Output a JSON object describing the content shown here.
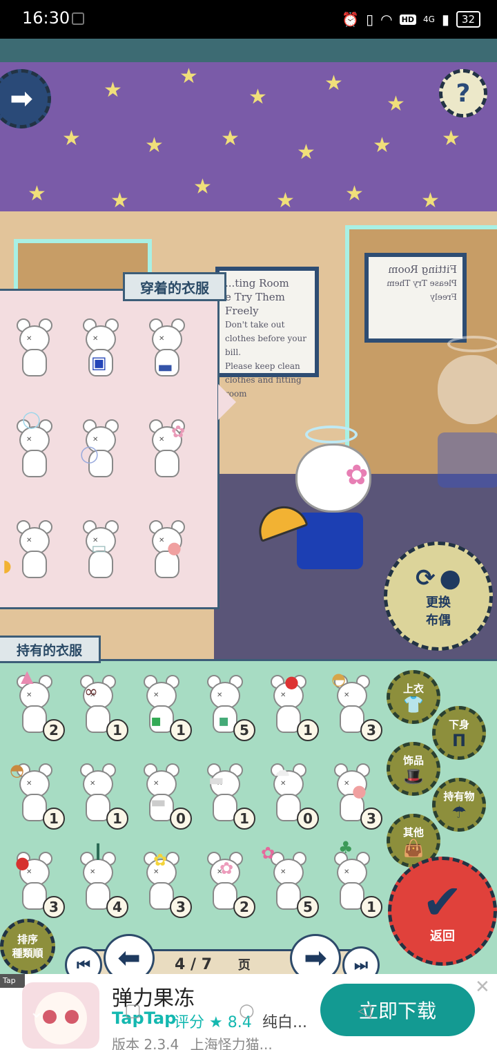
{
  "status_bar": {
    "time": "16:30",
    "network": "4G",
    "battery": "32",
    "hd": "HD"
  },
  "scene": {
    "fitting_sign_left": [
      "...ting Room",
      "e Try Them Freely",
      "Don't take out",
      "clothes before your bill.",
      "Please keep clean",
      "clothes and fitting room"
    ],
    "fitting_sign_right": [
      "Fitting Room",
      "Please Try Them Freely"
    ],
    "change_doll_label": [
      "更换",
      "布偶"
    ],
    "help_icon": "question-mark-icon",
    "back_icon": "arrow-right-icon"
  },
  "worn_panel": {
    "title": "穿着的衣服",
    "items": [
      {
        "icon": "plain-bear"
      },
      {
        "icon": "blue-check-outfit"
      },
      {
        "icon": "skirt-outfit"
      },
      {
        "icon": "halo"
      },
      {
        "icon": "blue-glow"
      },
      {
        "icon": "flower-hairpin"
      },
      {
        "icon": "paper-fan"
      },
      {
        "icon": "mask"
      },
      {
        "icon": "blush"
      }
    ]
  },
  "owned_panel": {
    "title": "持有的衣服",
    "items": [
      {
        "icon": "party-hat",
        "count": "2"
      },
      {
        "icon": "glasses-nose",
        "count": "1"
      },
      {
        "icon": "small-item",
        "count": "1"
      },
      {
        "icon": "green-item",
        "count": "5"
      },
      {
        "icon": "red-flower-clip",
        "count": "1"
      },
      {
        "icon": "straw-hat",
        "count": "3"
      },
      {
        "icon": "woven-basket-hat",
        "count": "1"
      },
      {
        "icon": "plain",
        "count": "1"
      },
      {
        "icon": "scarf",
        "count": "0"
      },
      {
        "icon": "headband",
        "count": "1"
      },
      {
        "icon": "white-wig",
        "count": "0"
      },
      {
        "icon": "blush",
        "count": "3"
      },
      {
        "icon": "strawberry-hat",
        "count": "3"
      },
      {
        "icon": "feather",
        "count": "4"
      },
      {
        "icon": "yellow-flower",
        "count": "3"
      },
      {
        "icon": "pink-flower",
        "count": "2"
      },
      {
        "icon": "big-pink-flowers",
        "count": "5"
      },
      {
        "icon": "bamboo",
        "count": "1"
      }
    ]
  },
  "categories": [
    {
      "label": "上衣",
      "icon": "shirt-icon"
    },
    {
      "label": "下身",
      "icon": "pants-icon"
    },
    {
      "label": "饰品",
      "icon": "hat-bow-icon"
    },
    {
      "label": "持有物",
      "icon": "umbrella-icon"
    },
    {
      "label": "其他",
      "icon": "bag-icon"
    }
  ],
  "return_label": "返回",
  "sort_label": [
    "排序",
    "種類順"
  ],
  "pagination": {
    "current": "4",
    "total": "7",
    "label": "页"
  },
  "ad": {
    "tag": "Tap",
    "title": "弹力果冻",
    "brand": "TapTap",
    "rating_label": "评分",
    "rating": "8.4",
    "developer_short": "纯白...",
    "version": "版本 2.3.4",
    "publisher": "上海怪力猫...",
    "download_label": "立即下载"
  },
  "colors": {
    "wall": "#7a5ba8",
    "owned_bg": "#a7dcc3",
    "worn_bg": "#f3dde0",
    "accent_red": "#e0413b",
    "download": "#139a92"
  }
}
